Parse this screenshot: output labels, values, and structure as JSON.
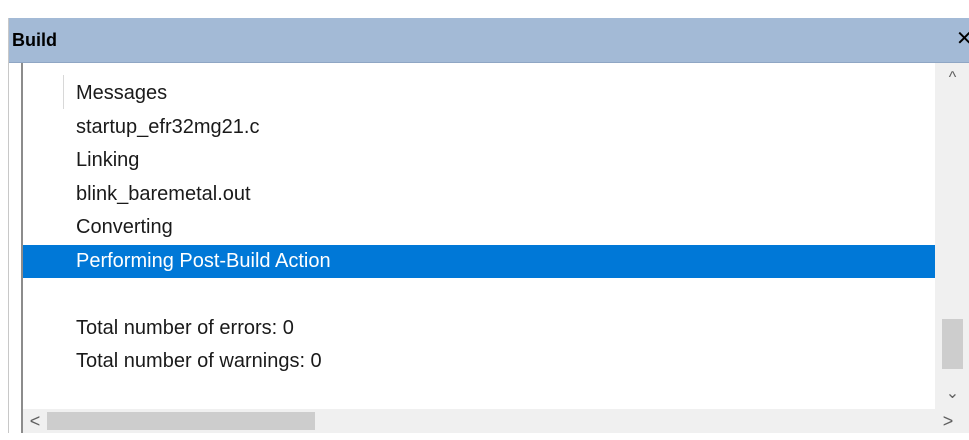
{
  "window": {
    "title": "Build",
    "close_glyph": "✕"
  },
  "messages": {
    "header": "Messages",
    "lines": [
      "startup_efr32mg21.c",
      "Linking",
      "blink_baremetal.out",
      "Converting",
      "Performing Post-Build Action",
      "",
      "Total number of errors: 0",
      "Total number of warnings: 0"
    ],
    "selected_index": 4
  },
  "scrollbars": {
    "up": "^",
    "down": "⌄",
    "left": "<",
    "right": ">"
  },
  "colors": {
    "titlebar": "#a3bad6",
    "selection": "#0078d7",
    "scrollbar_track": "#f0f0f0",
    "scrollbar_thumb": "#cdcdcd"
  }
}
